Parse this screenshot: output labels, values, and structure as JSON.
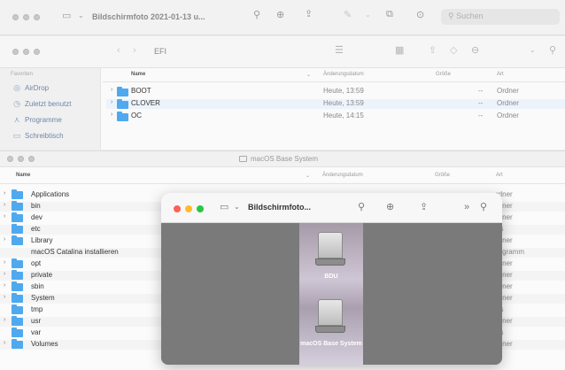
{
  "preview_window": {
    "title": "Bildschirmfoto 2021-01-13 u...",
    "search_placeholder": "Suchen"
  },
  "efi_window": {
    "folder_name": "EFI",
    "sidebar_heading": "Favoriten",
    "sidebar_items": [
      {
        "label": "AirDrop",
        "icon": "airdrop-icon"
      },
      {
        "label": "Zuletzt benutzt",
        "icon": "clock-icon"
      },
      {
        "label": "Programme",
        "icon": "apps-icon"
      },
      {
        "label": "Schreibtisch",
        "icon": "desktop-icon"
      }
    ],
    "columns": {
      "name": "Name",
      "date": "Änderungsdatum",
      "size": "Größe",
      "kind": "Art"
    },
    "rows": [
      {
        "name": "BOOT",
        "date": "Heute, 13:59",
        "size": "--",
        "kind": "Ordner"
      },
      {
        "name": "CLOVER",
        "date": "Heute, 13:59",
        "size": "--",
        "kind": "Ordner"
      },
      {
        "name": "OC",
        "date": "Heute, 14:15",
        "size": "--",
        "kind": "Ordner"
      }
    ]
  },
  "base_window": {
    "title": "macOS Base System",
    "columns": {
      "name": "Name",
      "date": "Änderungsdatum",
      "size": "Größe",
      "kind": "Art"
    },
    "rows": [
      {
        "name": "Applications",
        "kind": "rdner"
      },
      {
        "name": "bin",
        "kind": "rdner"
      },
      {
        "name": "dev",
        "kind": "rdner"
      },
      {
        "name": "etc",
        "kind": "as"
      },
      {
        "name": "Library",
        "kind": "rdner"
      },
      {
        "name": "macOS Catalina installieren",
        "kind": "rogramm"
      },
      {
        "name": "opt",
        "kind": "rdner"
      },
      {
        "name": "private",
        "kind": "rdner"
      },
      {
        "name": "sbin",
        "kind": "rdner"
      },
      {
        "name": "System",
        "kind": "rdner"
      },
      {
        "name": "tmp",
        "kind": "as"
      },
      {
        "name": "usr",
        "kind": "rdner"
      },
      {
        "name": "var",
        "kind": "as"
      },
      {
        "name": "Volumes",
        "kind": "rdner"
      }
    ]
  },
  "front_preview": {
    "title": "Bildschirmfoto...",
    "thumbnails": [
      {
        "label": "BDU"
      },
      {
        "label": "macOS Base System"
      }
    ]
  },
  "colors": {
    "folder_blue": "#4fa9ef",
    "traffic_red": "#fe5f57",
    "traffic_yellow": "#febc2e",
    "traffic_green": "#28c840"
  }
}
